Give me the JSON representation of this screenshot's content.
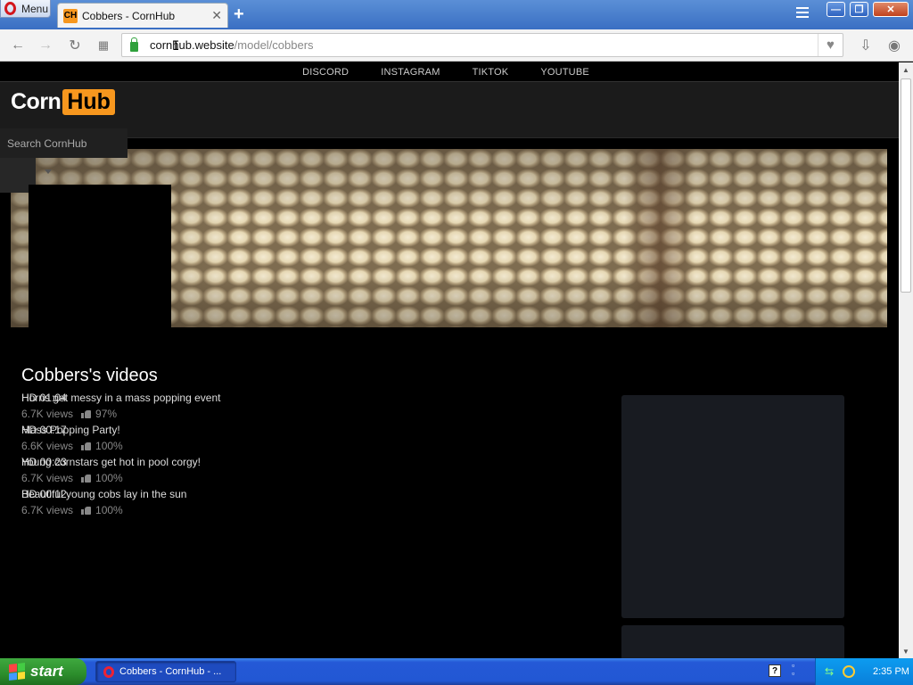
{
  "browser": {
    "menu_label": "Menu",
    "tab_title": "Cobbers - CornHub",
    "tab_favicon_text": "CH",
    "new_tab_symbol": "+",
    "url_host": "cornhub.website",
    "url_path": "/model/cobbers",
    "window_minimize": "—",
    "window_restore": "❐",
    "window_close": "✕"
  },
  "site": {
    "social_links": [
      "DISCORD",
      "INSTAGRAM",
      "TIKTOK",
      "YOUTUBE"
    ],
    "logo_part1": "Corn",
    "logo_part2": "Hub",
    "search_placeholder": "Search CornHub",
    "brand_color": "#f7971e",
    "videos_heading": "Cobbers's videos",
    "videos": [
      {
        "duration": "HD 01:04",
        "title": "Horns get messy in a mass popping event",
        "views": "6.7K views",
        "rating": "97%"
      },
      {
        "duration": "HD 00:17",
        "title": "Mass Popping Party!",
        "views": "6.6K views",
        "rating": "100%"
      },
      {
        "duration": "HD 00:23",
        "title": "Young cornstars get hot in pool corgy!",
        "views": "6.7K views",
        "rating": "100%"
      },
      {
        "duration": "HD 00:12",
        "title": "Beautiful young cobs lay in the sun",
        "views": "6.7K views",
        "rating": "100%"
      }
    ]
  },
  "taskbar": {
    "start_label": "start",
    "task_button_label": "Cobbers - CornHub - ...",
    "clock": "2:35 PM"
  }
}
